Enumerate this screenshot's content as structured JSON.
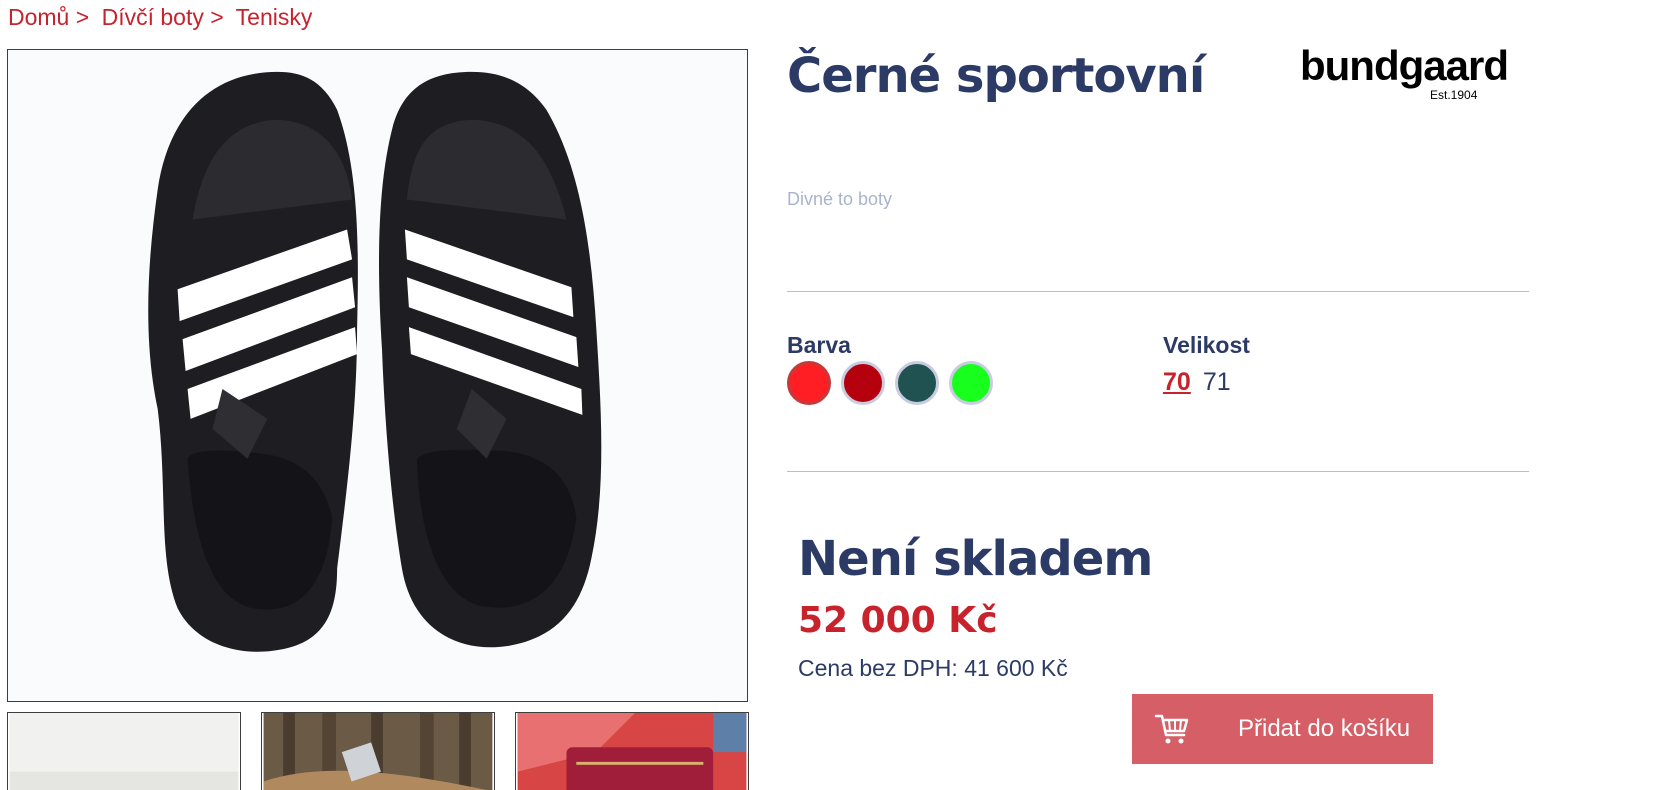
{
  "breadcrumb": {
    "items": [
      "Domů",
      "Dívčí boty",
      "Tenisky"
    ],
    "separator": ">"
  },
  "product": {
    "title": "Černé sportovní",
    "subtitle": "Divné to boty",
    "brand": {
      "name": "bundgaard",
      "tagline": "Est.1904"
    }
  },
  "color_section": {
    "label": "Barva",
    "swatches": [
      {
        "name": "red",
        "color": "#ff1e24",
        "selected": true
      },
      {
        "name": "dark-red",
        "color": "#b5000e",
        "selected": false
      },
      {
        "name": "dark-green",
        "color": "#1f5250",
        "selected": false
      },
      {
        "name": "green",
        "color": "#18ff1d",
        "selected": false
      }
    ]
  },
  "size_section": {
    "label": "Velikost",
    "sizes": [
      {
        "value": "70",
        "selected": true
      },
      {
        "value": "71",
        "selected": false
      }
    ]
  },
  "availability": {
    "status": "Není skladem",
    "price": "52 000 Kč",
    "price_net": "Cena bez DPH: 41 600 Kč"
  },
  "cart": {
    "label": "Přidat do košíku",
    "icon": "cart-icon"
  },
  "colors": {
    "accent": "#c8232c",
    "primary": "#2c3a66",
    "button": "#d65f67"
  }
}
